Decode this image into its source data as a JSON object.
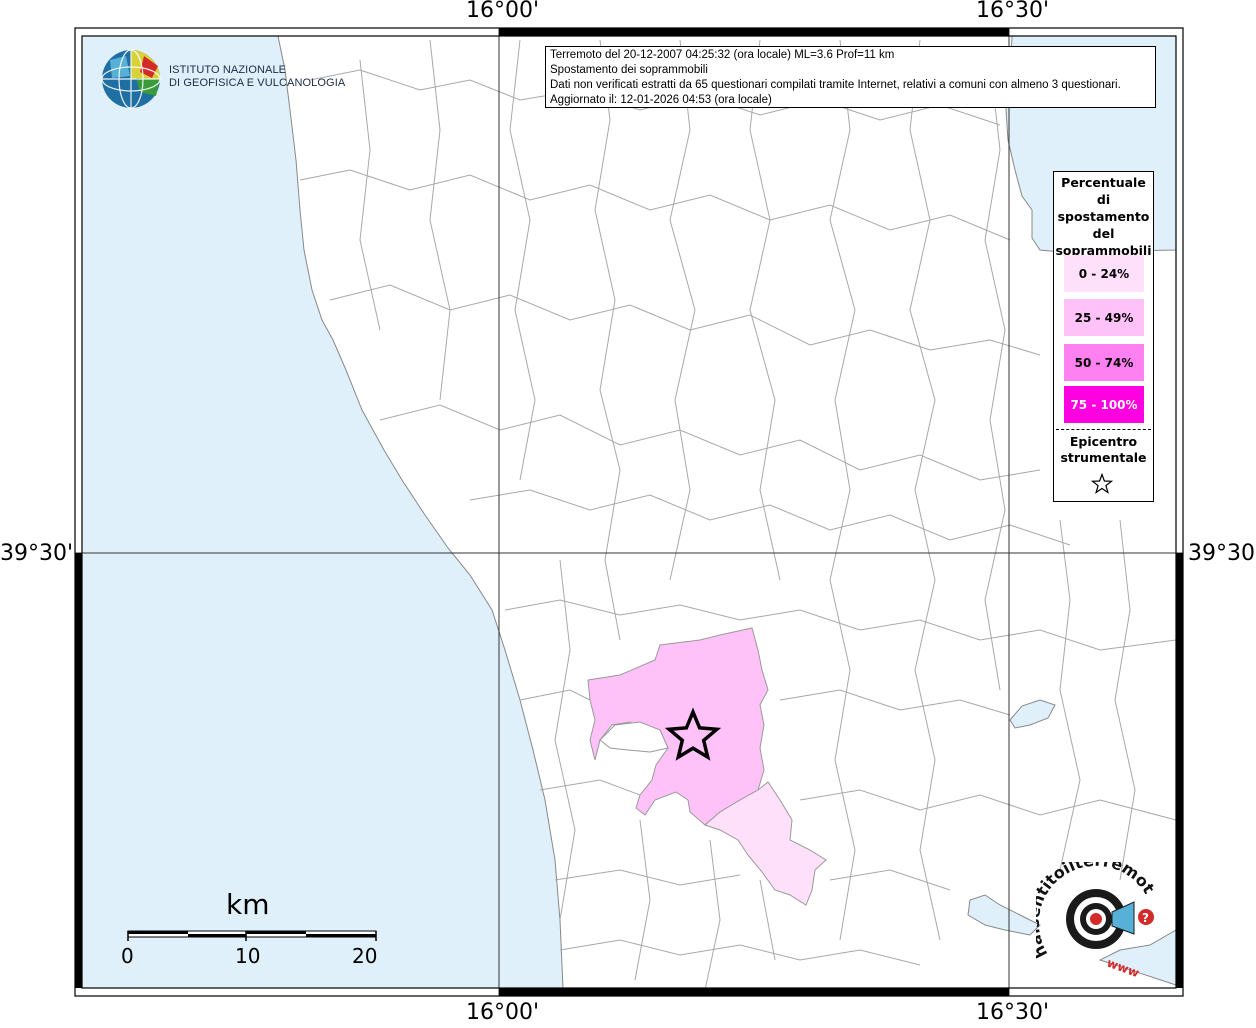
{
  "map": {
    "lon_ticks": [
      "16°00'",
      "16°30'"
    ],
    "lat_ticks": [
      "39°30'"
    ],
    "colors": {
      "sea": "#dff0fb",
      "land": "#ffffff",
      "boundary": "#aaaaaa",
      "frame": "#000000",
      "class_0_24": "#ffe0fb",
      "class_25_49": "#ffc2f8",
      "class_50_74": "#ff80f0",
      "class_75_100": "#ff00e0"
    }
  },
  "info": {
    "line1": "Terremoto del 20-12-2007 04:25:32 (ora locale) ML=3.6 Prof=11 km",
    "line2": "Spostamento dei soprammobili",
    "line3": "Dati non verificati estratti da 65 questionari compilati tramite Internet, relativi a comuni con almeno 3 questionari.",
    "line4": "Aggiornato il: 12-01-2026 04:53 (ora locale)"
  },
  "legend": {
    "title_lines": [
      "Percentuale",
      "di",
      "spostamento",
      "del",
      "soprammobili"
    ],
    "classes": [
      {
        "label": "0 - 24%"
      },
      {
        "label": "25 - 49%"
      },
      {
        "label": "50 - 74%"
      },
      {
        "label": "75 - 100%"
      }
    ],
    "epicenter_lines": [
      "Epicentro",
      "strumentale"
    ],
    "epicenter_icon": "star-outline-icon"
  },
  "ingv": {
    "line1": "ISTITUTO NAZIONALE",
    "line2": "DI GEOFISICA E VULCANOLOGIA"
  },
  "scale": {
    "unit": "km",
    "labels": [
      "0",
      "10",
      "20"
    ]
  },
  "hst_logo": {
    "text": "haisentitoilterremoto.it",
    "www": "www",
    "question": "?"
  }
}
